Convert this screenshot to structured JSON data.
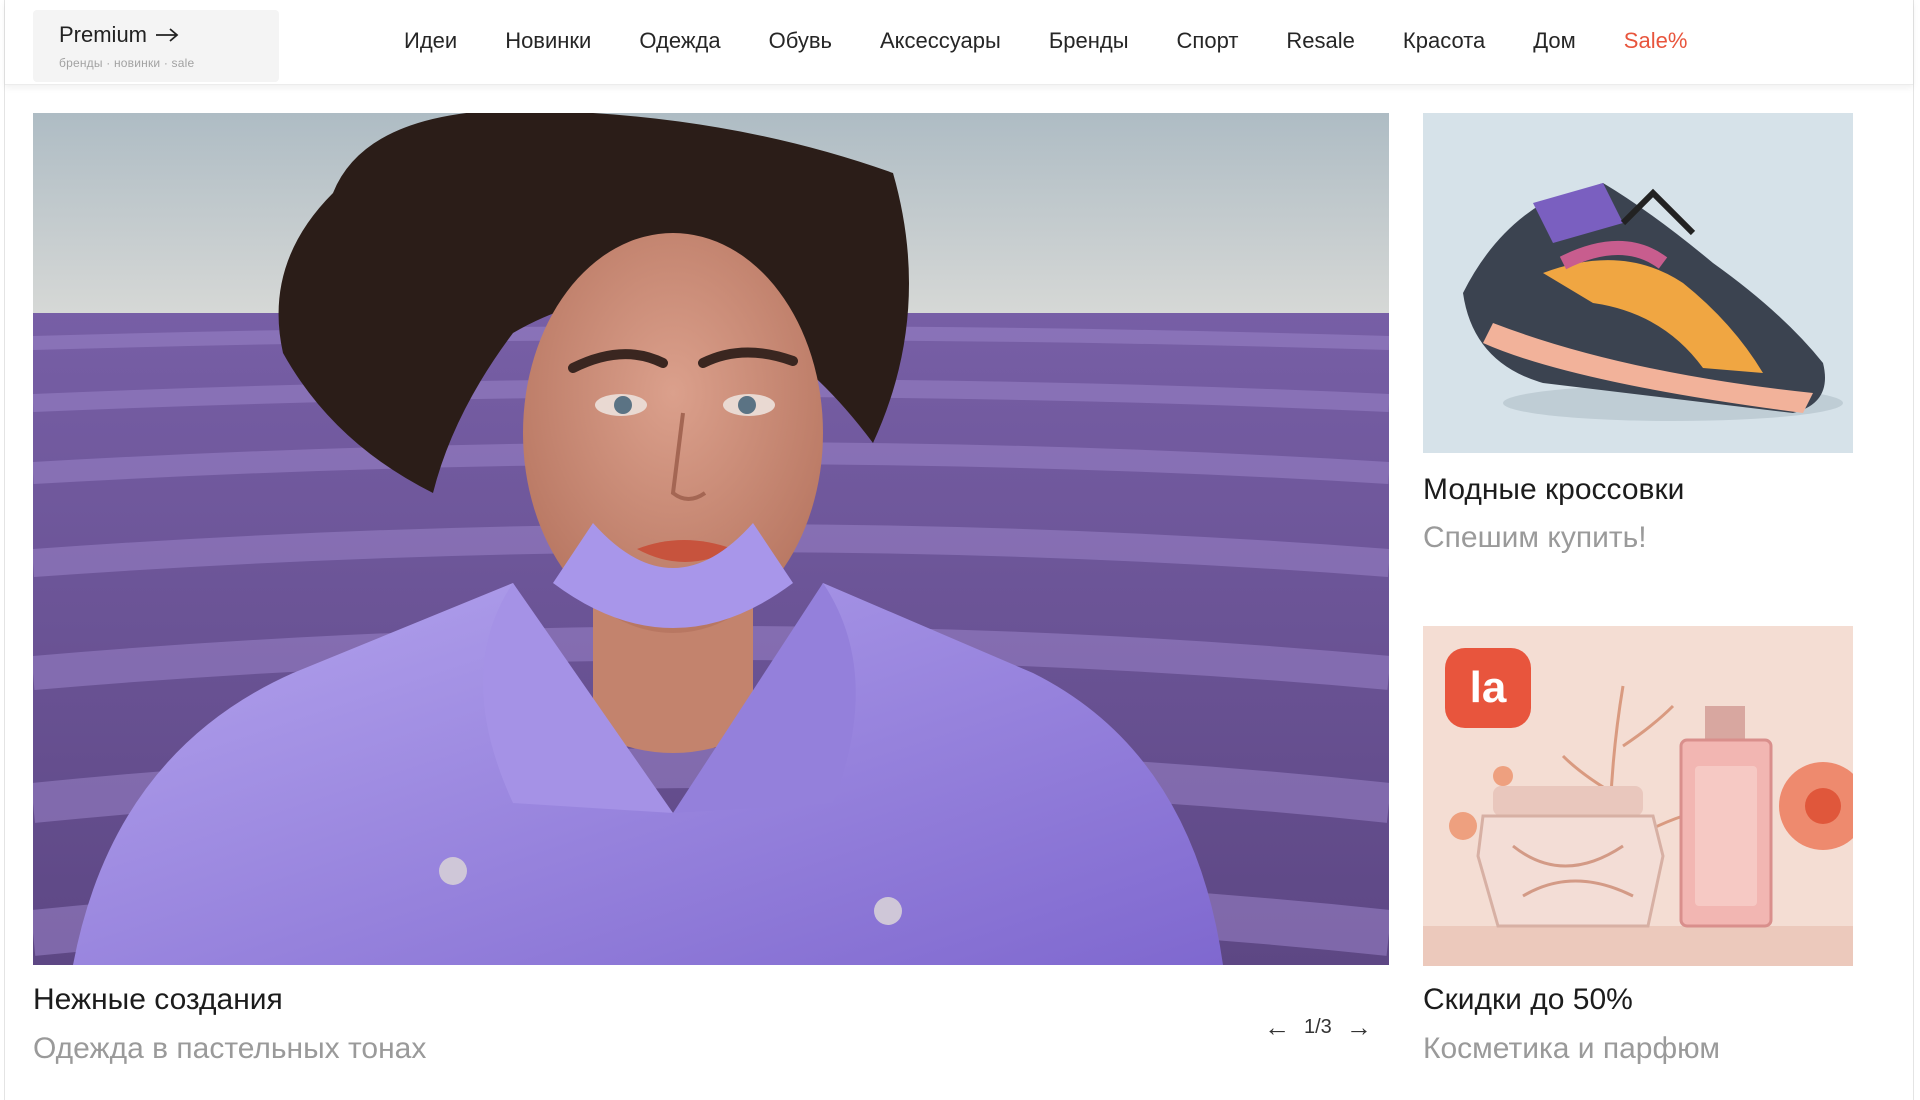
{
  "header": {
    "premium_title": "Premium",
    "premium_sub": "бренды · новинки · sale",
    "nav": [
      "Идеи",
      "Новинки",
      "Одежда",
      "Обувь",
      "Аксессуары",
      "Бренды",
      "Спорт",
      "Resale",
      "Красота",
      "Дом"
    ],
    "sale_label": "Sale%",
    "sale_color": "#e8553d"
  },
  "hero": {
    "title": "Нежные создания",
    "subtitle": "Одежда в пастельных тонах",
    "pager": "1/3"
  },
  "cards": [
    {
      "title": "Модные кроссовки",
      "subtitle": "Спешим купить!"
    },
    {
      "badge": "la",
      "title": "Скидки до 50%",
      "subtitle": "Косметика и парфюм"
    }
  ],
  "colors": {
    "lavender": "#8a6fb5",
    "coat": "#9a86e0",
    "badge": "#e8553d"
  }
}
